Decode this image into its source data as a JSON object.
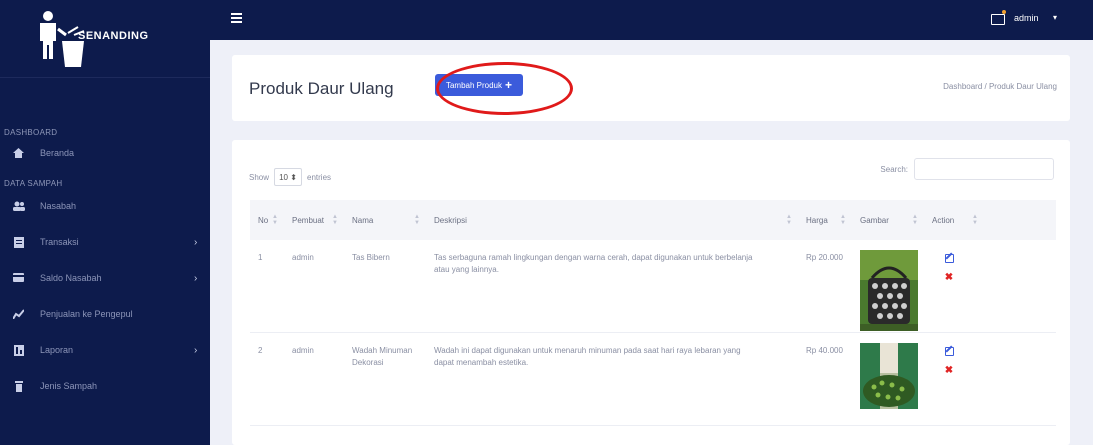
{
  "brand": {
    "name": "SENANDING"
  },
  "sidebar": {
    "sections": [
      {
        "heading": "DASHBOARD",
        "items": [
          {
            "label": "Beranda",
            "icon": "home-icon",
            "has_submenu": false
          }
        ]
      },
      {
        "heading": "DATA SAMPAH",
        "items": [
          {
            "label": "Nasabah",
            "icon": "users-icon",
            "has_submenu": false
          },
          {
            "label": "Transaksi",
            "icon": "receipt-icon",
            "has_submenu": true
          },
          {
            "label": "Saldo Nasabah",
            "icon": "wallet-icon",
            "has_submenu": true
          },
          {
            "label": "Penjualan ke Pengepul",
            "icon": "chart-icon",
            "has_submenu": false
          },
          {
            "label": "Laporan",
            "icon": "report-icon",
            "has_submenu": true
          },
          {
            "label": "Jenis Sampah",
            "icon": "trash-icon",
            "has_submenu": false
          }
        ]
      }
    ]
  },
  "topbar": {
    "user": "admin",
    "caret": "▾"
  },
  "header": {
    "title": "Produk Daur Ulang",
    "add_button": "Tambah Produk",
    "breadcrumb": "Dashboard / Produk Daur Ulang"
  },
  "table": {
    "show_label": "Show",
    "entries_value": "10 ⬍",
    "entries_label": "entries",
    "search_label": "Search:",
    "columns": [
      "No",
      "Pembuat",
      "Nama",
      "Deskripsi",
      "Harga",
      "Gambar",
      "Action"
    ],
    "rows": [
      {
        "no": "1",
        "pembuat": "admin",
        "nama": "Tas Bibern",
        "deskripsi": "Tas serbaguna ramah lingkungan dengan warna cerah, dapat digunakan untuk berbelanja atau yang lainnya.",
        "harga": "Rp 20.000"
      },
      {
        "no": "2",
        "pembuat": "admin",
        "nama": "Wadah Minuman Dekorasi",
        "deskripsi": "Wadah ini dapat digunakan untuk menaruh minuman pada saat hari raya lebaran yang dapat menambah estetika.",
        "harga": "Rp 40.000"
      }
    ]
  },
  "colors": {
    "sidebar": "#0d1b4c",
    "accent": "#3b5bdb",
    "highlight": "#e01a1a",
    "delete": "#e02424"
  }
}
